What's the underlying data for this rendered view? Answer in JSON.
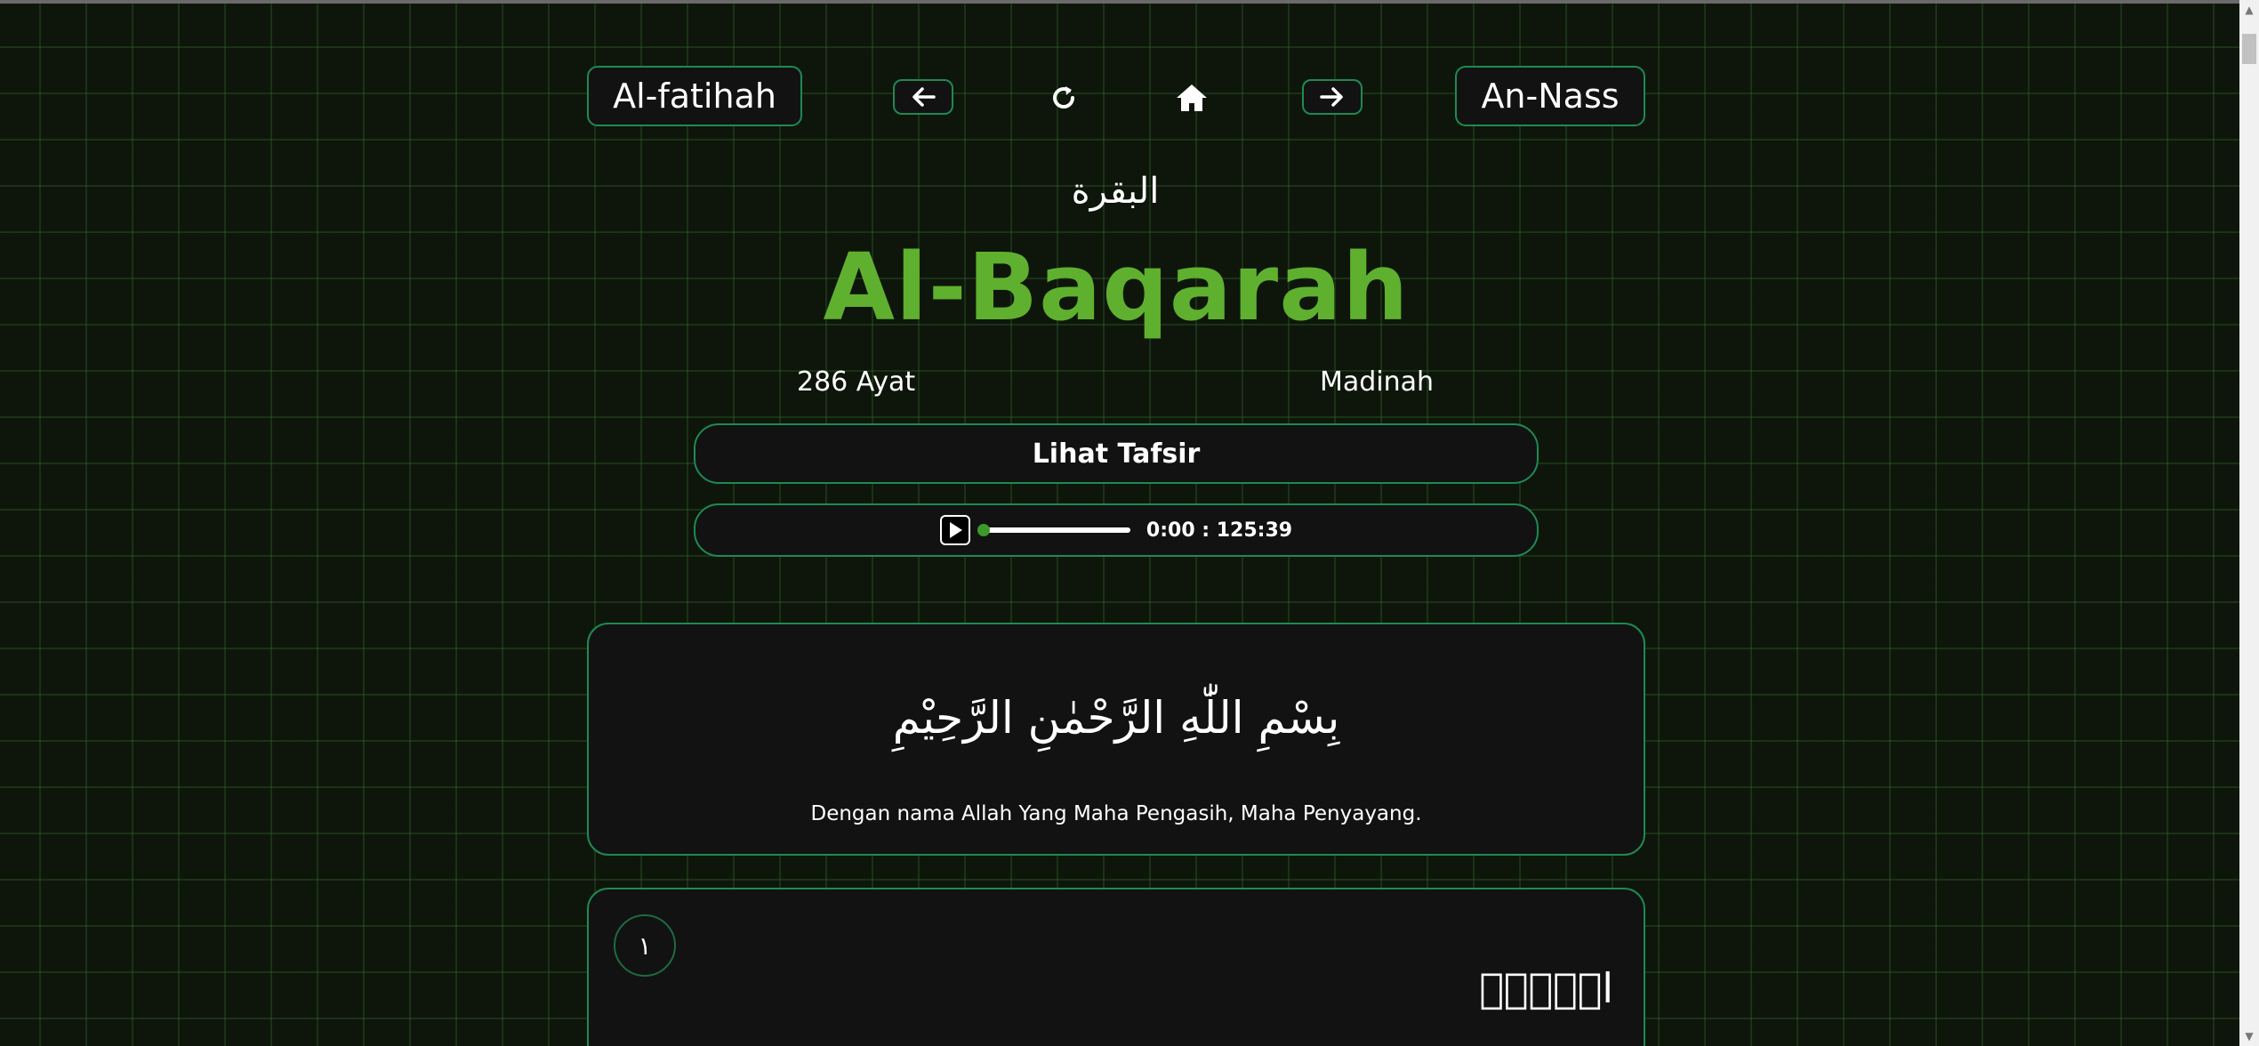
{
  "nav": {
    "prev_surah": "Al-fatihah",
    "next_surah": "An-Nass",
    "prev_icon": "arrow-left-icon",
    "refresh_icon": "refresh-icon",
    "home_icon": "home-icon",
    "next_icon": "arrow-right-icon"
  },
  "surah": {
    "arabic_name": "البقرة",
    "latin_name": "Al-Baqarah",
    "ayat_count": "286 Ayat",
    "revelation_place": "Madinah"
  },
  "tafsir_button": "Lihat Tafsir",
  "audio": {
    "time": "0:00 : 125:39",
    "progress": 0
  },
  "bismillah": {
    "arabic": "بِسْمِ اللّٰهِ الرَّحْمٰنِ الرَّحِيْمِ",
    "translation": "Dengan nama Allah Yang Maha Pengasih, Maha Penyayang."
  },
  "ayahs": [
    {
      "number": "١",
      "arabic": "الۤمّۤ"
    }
  ],
  "colors": {
    "accent": "#1e8a52",
    "title": "#5fb02e",
    "background": "#0e160b",
    "card": "#121212"
  }
}
